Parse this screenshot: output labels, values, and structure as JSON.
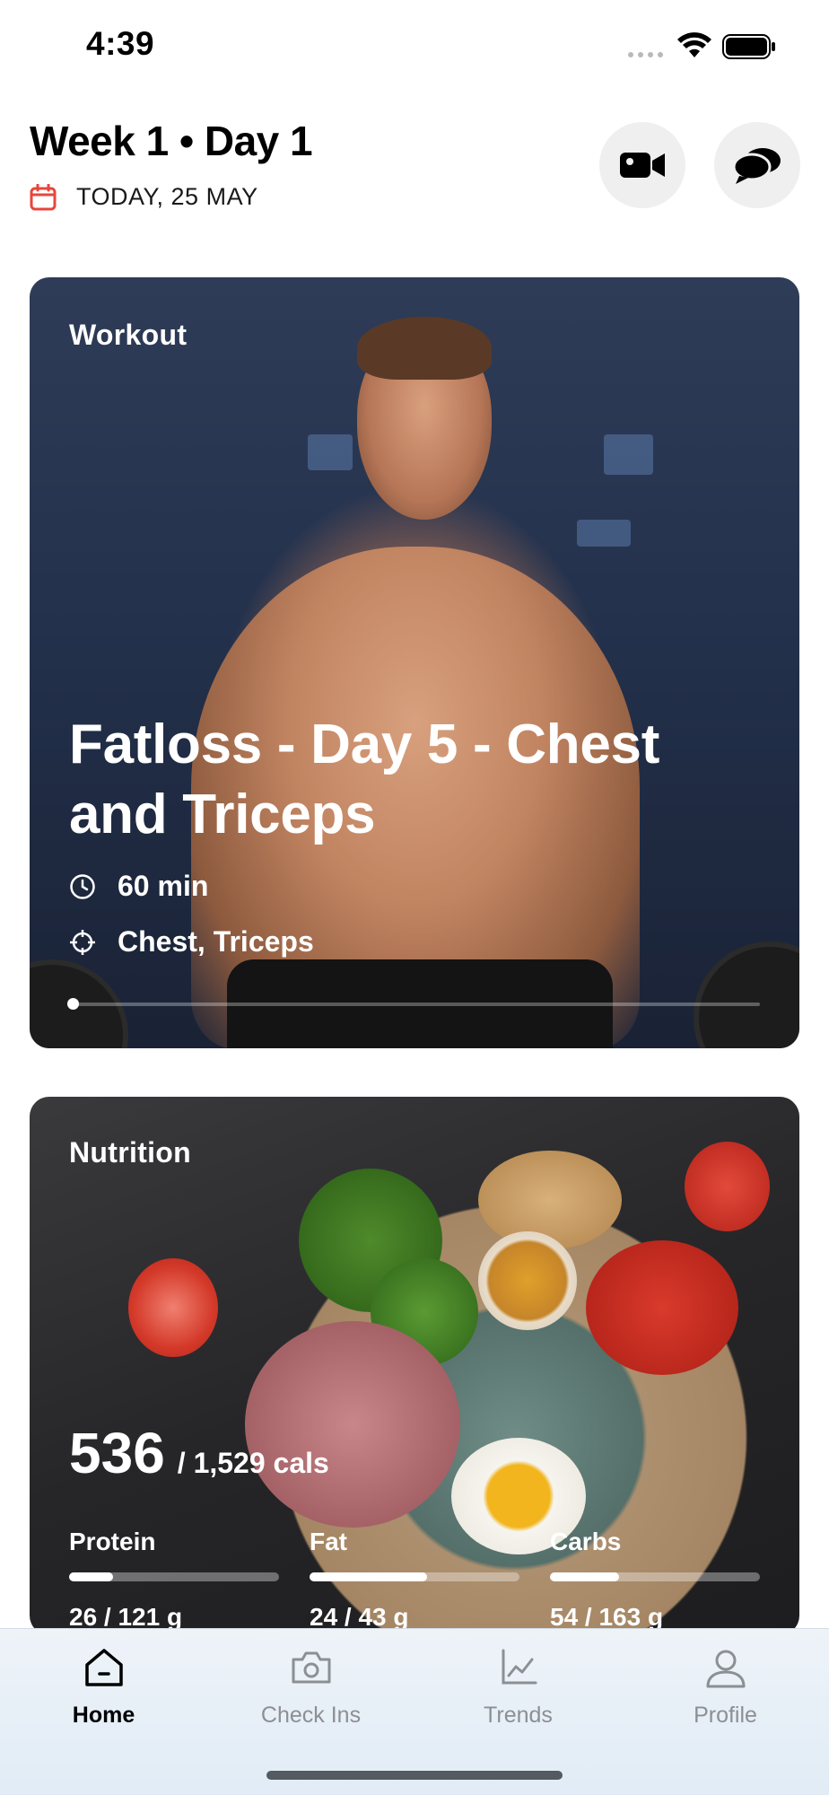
{
  "status_bar": {
    "time": "4:39"
  },
  "header": {
    "title": "Week 1 • Day 1",
    "date": "TODAY, 25 MAY"
  },
  "workout": {
    "section_label": "Workout",
    "title": "Fatloss - Day 5 - Chest and Triceps",
    "duration": "60 min",
    "targets": "Chest, Triceps",
    "progress": 0
  },
  "nutrition": {
    "section_label": "Nutrition",
    "calories_current": "536",
    "calories_target": "/ 1,529 cals",
    "macros": [
      {
        "name": "Protein",
        "value": "26 / 121 g",
        "fraction": 0.21
      },
      {
        "name": "Fat",
        "value": "24 / 43 g",
        "fraction": 0.56
      },
      {
        "name": "Carbs",
        "value": "54 / 163 g",
        "fraction": 0.33
      }
    ]
  },
  "tab_bar": {
    "tabs": [
      {
        "label": "Home",
        "icon": "home-icon",
        "active": true
      },
      {
        "label": "Check Ins",
        "icon": "camera-icon",
        "active": false
      },
      {
        "label": "Trends",
        "icon": "chart-icon",
        "active": false
      },
      {
        "label": "Profile",
        "icon": "person-icon",
        "active": false
      }
    ]
  },
  "colors": {
    "accent_red": "#e8453c",
    "tab_inactive": "#8c8f94"
  }
}
